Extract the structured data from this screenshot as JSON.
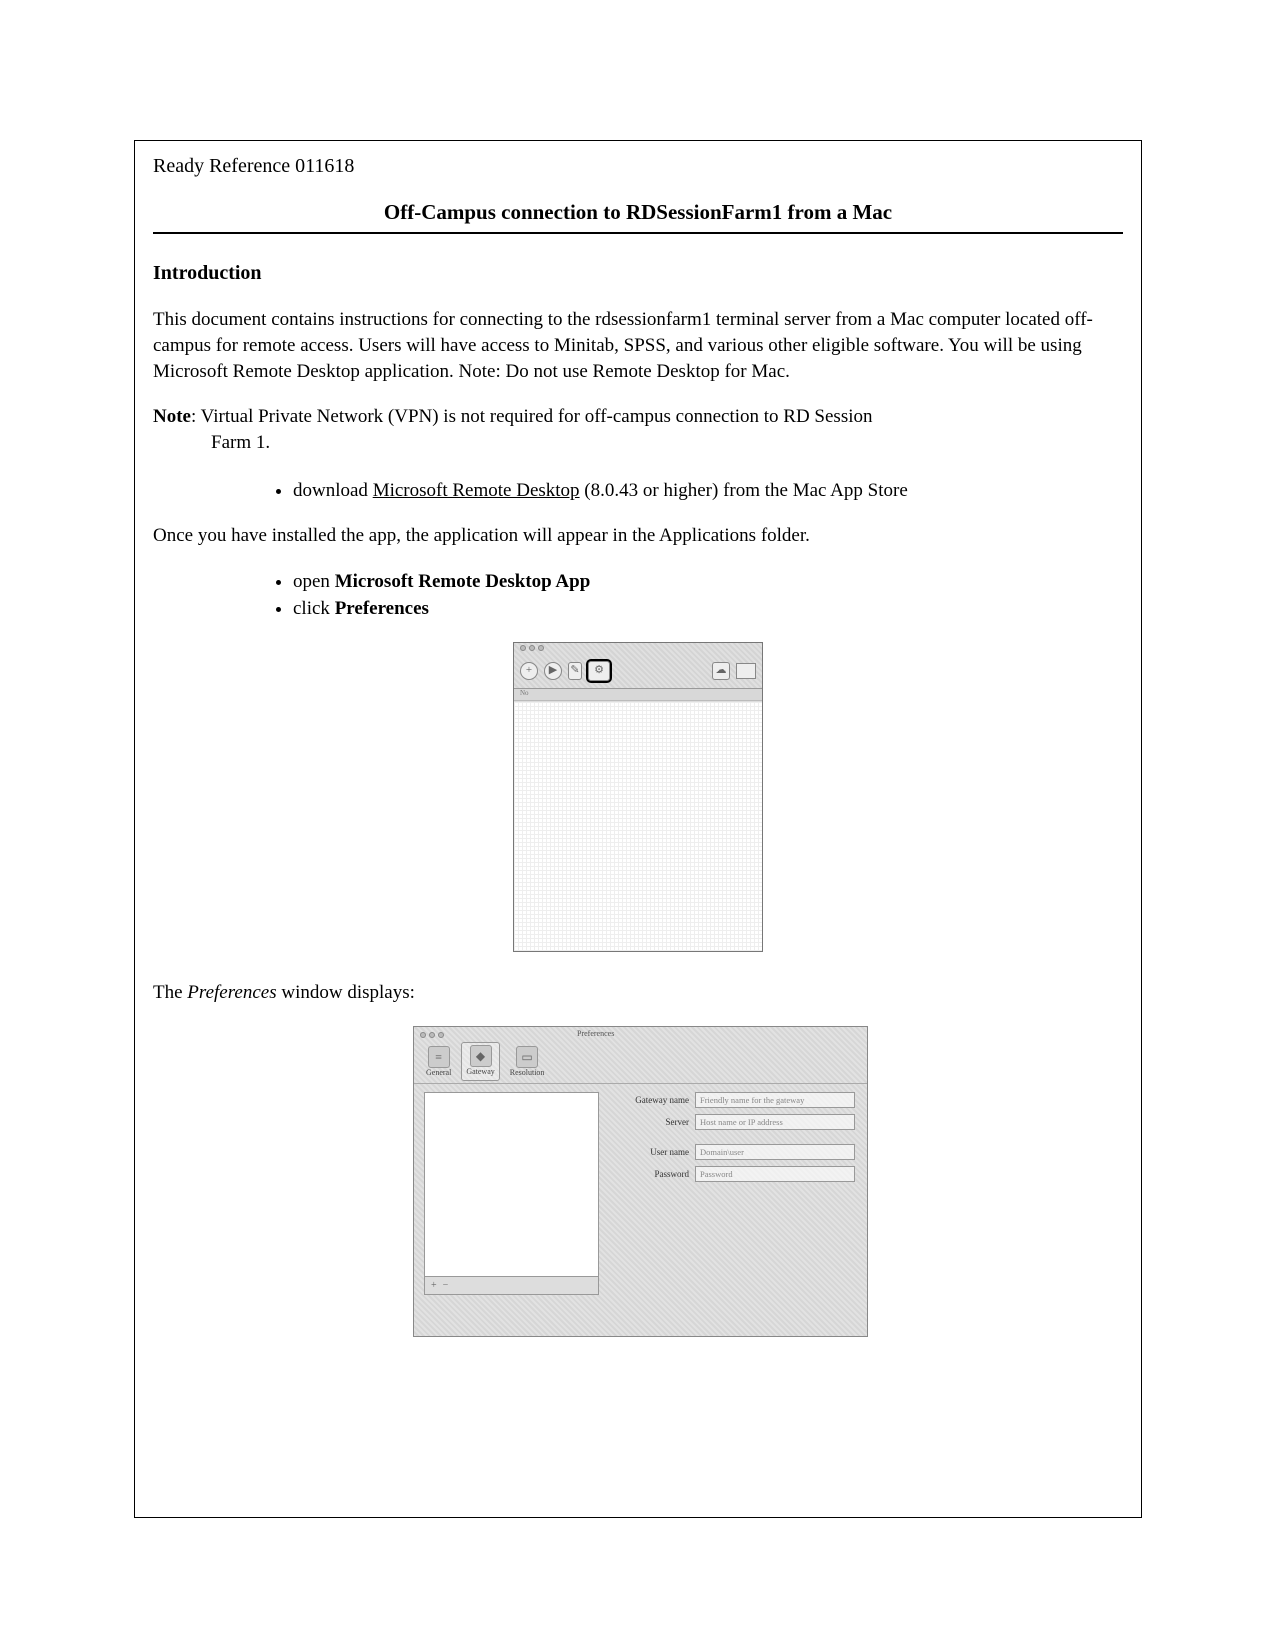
{
  "header": {
    "ref": "Ready Reference 011618"
  },
  "title": "Off-Campus connection to RDSessionFarm1 from a Mac",
  "intro_head": "Introduction",
  "intro_para": "This document contains instructions for connecting to the rdsessionfarm1 terminal server from a Mac computer located off-campus for remote access.  Users will have access to Minitab, SPSS, and various other eligible software. You will be using Microsoft Remote Desktop application. Note: Do not use Remote Desktop for Mac.",
  "note": {
    "label": "Note",
    "sep": ": ",
    "body_line1": "Virtual Private Network (VPN) is not required for off-campus connection to RD Session",
    "body_line2": "Farm 1."
  },
  "bullets1": {
    "b1_pre": "download ",
    "b1_link": "Microsoft Remote Desktop",
    "b1_post": " (8.0.43 or  higher) from the Mac App Store"
  },
  "after_install": "Once you have installed the app, the application will appear in the Applications folder.",
  "bullets2": {
    "b1_pre": "open ",
    "b1_strong": "Microsoft Remote Desktop App",
    "b2_pre": "click ",
    "b2_strong": "Preferences"
  },
  "shot1": {
    "sublabel": "No"
  },
  "prefs_sentence_pre": "The ",
  "prefs_sentence_em": "Preferences",
  "prefs_sentence_post": " window displays:",
  "shot2": {
    "window_title": "Preferences",
    "tabs": {
      "general": "General",
      "gateway": "Gateway",
      "resolution": "Resolution"
    },
    "fields": {
      "gateway_name": {
        "label": "Gateway name",
        "placeholder": "Friendly name for the gateway"
      },
      "server": {
        "label": "Server",
        "placeholder": "Host name or IP address"
      },
      "username": {
        "label": "User name",
        "placeholder": "Domain\\user"
      },
      "password": {
        "label": "Password",
        "placeholder": "Password"
      }
    },
    "add": "+",
    "remove": "−"
  }
}
